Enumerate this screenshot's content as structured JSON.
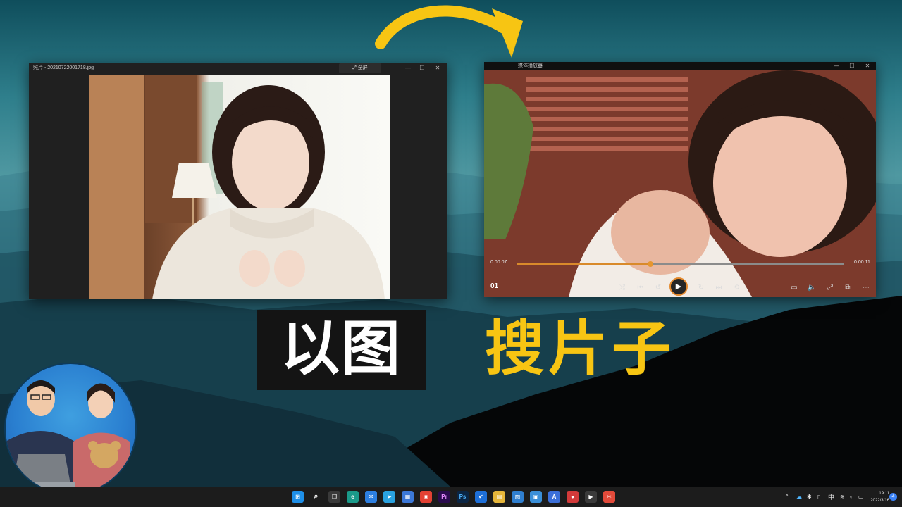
{
  "photo_viewer": {
    "title": "照片 - 20210722001718.jpg",
    "fullscreen_label": "全屏",
    "fullscreen_icon": "expand-icon",
    "controls": {
      "minimize": "—",
      "maximize": "☐",
      "close": "✕"
    }
  },
  "media_player": {
    "title": "媒体播放器",
    "elapsed": "0:00:07",
    "duration": "0:00:11",
    "progress": 0.41,
    "track_label": "01",
    "controls": {
      "minimize": "—",
      "maximize": "☐",
      "close": "✕"
    }
  },
  "headline": {
    "white_text": "以图",
    "yellow_text": "搜片子"
  },
  "taskbar": {
    "tray_ime": "中",
    "time": "19:11",
    "date": "2022/3/16",
    "notification_count": "4",
    "ps_label": "Ps",
    "pr_label": "Pr"
  },
  "colors": {
    "accent_yellow": "#f7c513",
    "seek_orange": "#d98a2b",
    "taskbar": "#1c1c1c"
  }
}
